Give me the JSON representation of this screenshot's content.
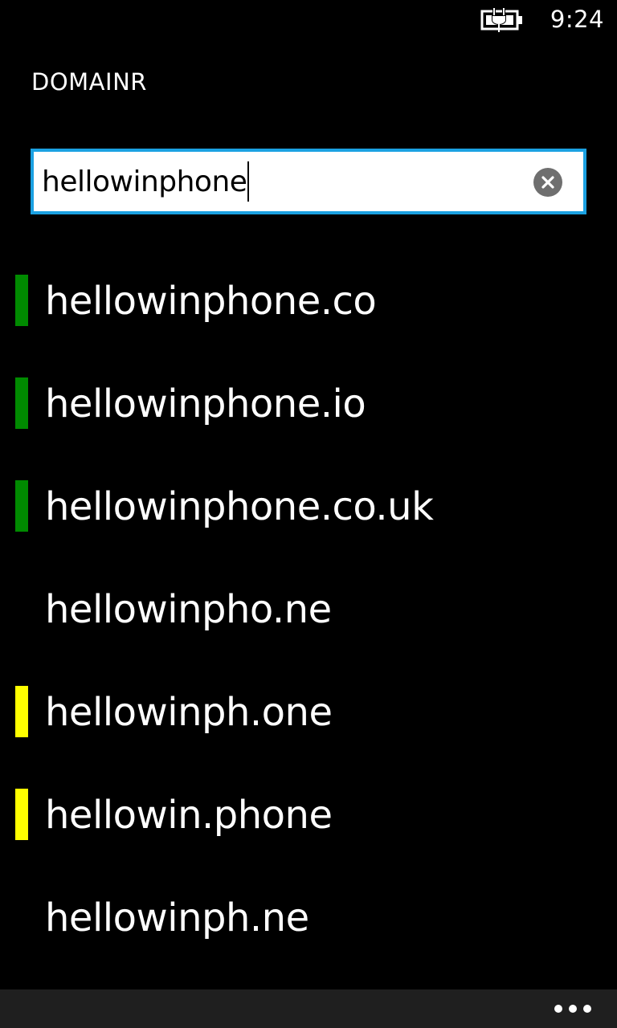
{
  "status_bar": {
    "time": "9:24",
    "battery_icon": "battery-charging-icon"
  },
  "app": {
    "title": "DOMAINR"
  },
  "search": {
    "value": "hellowinphone",
    "clear_icon": "clear-icon",
    "border_color": "#1ba1e2"
  },
  "status_colors": {
    "available": "#008a00",
    "maybe": "#ffff00",
    "taken": "#000000"
  },
  "results": [
    {
      "domain": "hellowinphone.co",
      "status": "available"
    },
    {
      "domain": "hellowinphone.io",
      "status": "available"
    },
    {
      "domain": "hellowinphone.co.uk",
      "status": "available"
    },
    {
      "domain": "hellowinpho.ne",
      "status": "taken"
    },
    {
      "domain": "hellowinph.one",
      "status": "maybe"
    },
    {
      "domain": "hellowin.phone",
      "status": "maybe"
    },
    {
      "domain": "hellowinph.ne",
      "status": "taken"
    }
  ],
  "app_bar": {
    "more_icon": "more-icon"
  }
}
